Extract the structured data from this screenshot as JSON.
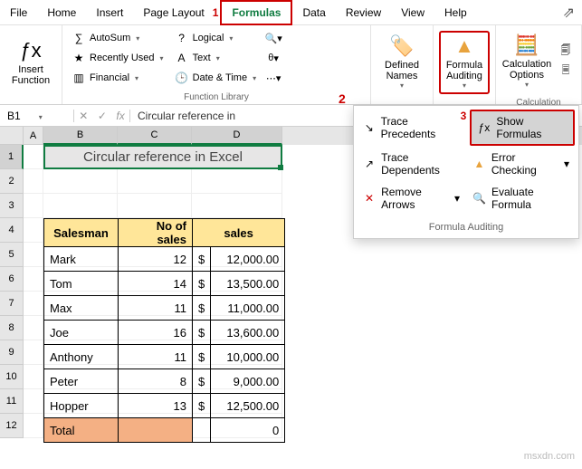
{
  "menubar": {
    "tabs": [
      "File",
      "Home",
      "Insert",
      "Page Layout",
      "Formulas",
      "Data",
      "Review",
      "View",
      "Help"
    ],
    "active_index": 4,
    "callout1": "1"
  },
  "ribbon": {
    "insert_function": "Insert\nFunction",
    "fl": {
      "autosum": "AutoSum",
      "recent": "Recently Used",
      "financial": "Financial",
      "logical": "Logical",
      "text": "Text",
      "datetime": "Date & Time",
      "group_label": "Function Library"
    },
    "defined": {
      "label": "Defined\nNames",
      "group_label": ""
    },
    "auditing": {
      "label": "Formula\nAuditing",
      "group_label": "",
      "callout2": "2"
    },
    "calc": {
      "label": "Calculation\nOptions",
      "group_label": "Calculation"
    }
  },
  "namebox": "B1",
  "formula_bar": "Circular reference in",
  "title_text": "Circular reference in Excel",
  "table": {
    "headers": [
      "Salesman",
      "No of sales",
      "sales"
    ],
    "rows": [
      {
        "name": "Mark",
        "qty": "12",
        "cur": "$",
        "amt": "12,000.00"
      },
      {
        "name": "Tom",
        "qty": "14",
        "cur": "$",
        "amt": "13,500.00"
      },
      {
        "name": "Max",
        "qty": "11",
        "cur": "$",
        "amt": "11,000.00"
      },
      {
        "name": "Joe",
        "qty": "16",
        "cur": "$",
        "amt": "13,600.00"
      },
      {
        "name": "Anthony",
        "qty": "11",
        "cur": "$",
        "amt": "10,000.00"
      },
      {
        "name": "Peter",
        "qty": "8",
        "cur": "$",
        "amt": "9,000.00"
      },
      {
        "name": "Hopper",
        "qty": "13",
        "cur": "$",
        "amt": "12,500.00"
      }
    ],
    "total_label": "Total",
    "total_value": "0"
  },
  "dropdown": {
    "trace_prec": "Trace Precedents",
    "trace_dep": "Trace Dependents",
    "remove_arrows": "Remove Arrows",
    "show_formulas": "Show Formulas",
    "error_check": "Error Checking",
    "eval": "Evaluate Formula",
    "callout3": "3",
    "label": "Formula Auditing"
  },
  "watermark": "msxdn.com"
}
